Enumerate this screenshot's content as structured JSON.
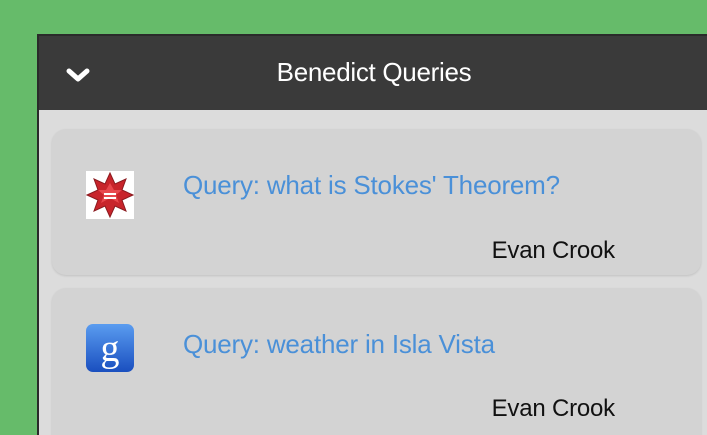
{
  "colors": {
    "background": "#66bb6a",
    "header_bg": "#3a3a3a",
    "card_bg": "#d3d3d3",
    "link": "#4a90d8"
  },
  "panel": {
    "title": "Benedict Queries",
    "toggle_icon": "chevron-down-icon"
  },
  "queries": [
    {
      "text": "Query: what is Stokes' Theorem?",
      "author": "Evan Crook",
      "source_icon": "wolfram-alpha-icon"
    },
    {
      "text": "Query: weather in Isla Vista",
      "author": "Evan Crook",
      "source_icon": "google-icon"
    }
  ]
}
